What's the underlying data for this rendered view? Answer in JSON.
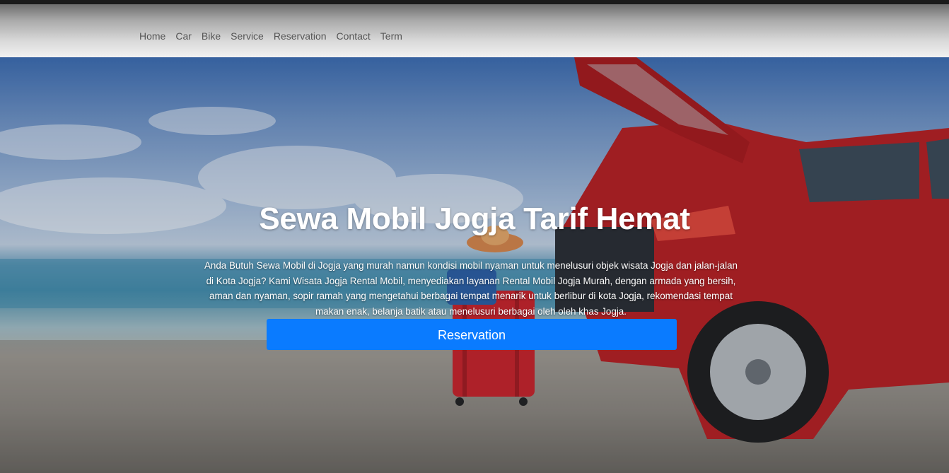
{
  "nav": {
    "items": [
      {
        "label": "Home"
      },
      {
        "label": "Car"
      },
      {
        "label": "Bike"
      },
      {
        "label": "Service"
      },
      {
        "label": "Reservation"
      },
      {
        "label": "Contact"
      },
      {
        "label": "Term"
      }
    ]
  },
  "hero": {
    "title": "Sewa Mobil Jogja Tarif Hemat",
    "description": "Anda Butuh Sewa Mobil di Jogja yang murah namun kondisi mobil nyaman untuk menelusuri objek wisata Jogja dan jalan-jalan di Kota Jogja? Kami Wisata Jogja Rental Mobil, menyediakan layanan Rental Mobil Jogja Murah, dengan armada yang bersih, aman dan nyaman, sopir ramah yang mengetahui berbagai tempat menarik untuk berlibur di kota Jogja, rekomendasi tempat makan enak, belanja batik atau menelusuri berbagai oleh oleh khas Jogja.",
    "button_label": "Reservation"
  },
  "colors": {
    "accent": "#0a7bff",
    "car": "#b81f22",
    "suitcase": "#c9232a"
  }
}
